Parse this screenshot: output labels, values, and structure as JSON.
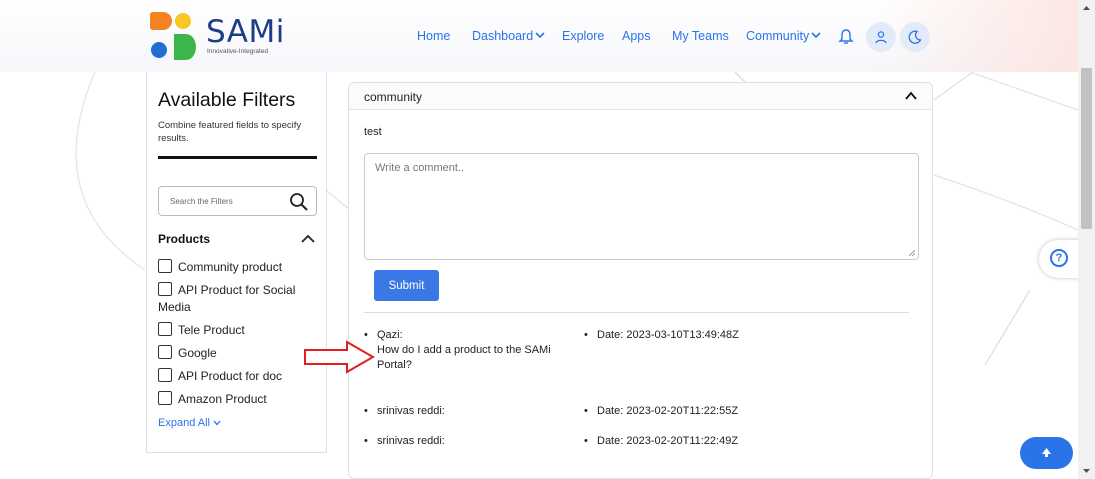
{
  "brand": {
    "logo_text": "SAMi",
    "tagline": "Innovative-Integrated",
    "colors": {
      "primary": "#2a73e8",
      "logo_blue": "#1f3c88",
      "logo_orange": "#f58220",
      "logo_yellow": "#f9c623",
      "logo_green": "#3cb54a"
    }
  },
  "nav": {
    "items": [
      {
        "label": "Home",
        "icon": null
      },
      {
        "label": "Dashboard",
        "icon": "chevron-down-icon"
      },
      {
        "label": "Explore",
        "icon": null
      },
      {
        "label": "Apps",
        "icon": null
      },
      {
        "label": "My Teams",
        "icon": null
      },
      {
        "label": "Community",
        "icon": "chevron-down-icon"
      }
    ],
    "icons": [
      "bell-icon",
      "user-icon",
      "moon-icon"
    ]
  },
  "filters": {
    "title": "Available Filters",
    "description": "Combine featured fields to specify results.",
    "search_placeholder": "Search the Filters",
    "section_title": "Products",
    "options": [
      {
        "label": "Community product",
        "checked": false
      },
      {
        "label": "API Product for Social Media",
        "checked": false
      },
      {
        "label": "Tele Product",
        "checked": false
      },
      {
        "label": "Google",
        "checked": false
      },
      {
        "label": "API Product for doc",
        "checked": false
      },
      {
        "label": "Amazon Product",
        "checked": false
      }
    ],
    "expand_label": "Expand All"
  },
  "post": {
    "header": "community",
    "body": "test",
    "comment_placeholder": "Write a comment..",
    "submit_label": "Submit"
  },
  "comments": [
    {
      "author": "Qazi:",
      "text": "How do I add a product to the SAMi Portal?",
      "date": "Date: 2023-03-10T13:49:48Z"
    },
    {
      "author": "srinivas reddi:",
      "text": "",
      "date": "Date: 2023-02-20T11:22:55Z"
    },
    {
      "author": "srinivas reddi:",
      "text": "",
      "date": "Date: 2023-02-20T11:22:49Z"
    }
  ],
  "help_label": "?",
  "annotation": {
    "arrow_color": "#e02020"
  }
}
